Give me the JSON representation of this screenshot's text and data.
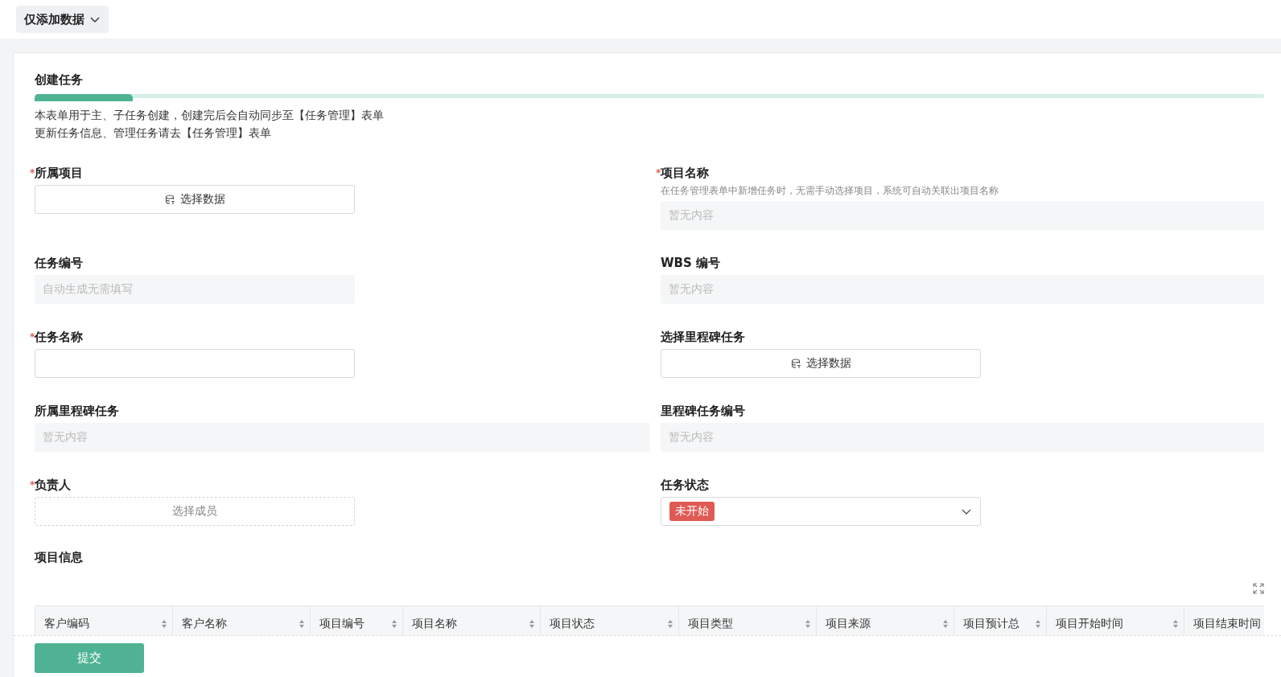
{
  "view_switch": {
    "label": "仅添加数据",
    "expanded": false
  },
  "form": {
    "tab": {
      "label": "创建任务",
      "selected": true
    },
    "description": [
      "本表单用于主、子任务创建，创建完后会自动同步至【任务管理】表单",
      "更新任务信息、管理任务请去【任务管理】表单"
    ],
    "rows": [
      [
        {
          "kind": "picker",
          "marker": "*",
          "label": "所属项目",
          "button": "选择数据"
        },
        {
          "kind": "readonly",
          "marker": "*",
          "label": "项目名称",
          "hint": "在任务管理表单中新增任务时，无需手动选择项目，系统可自动关联出项目名称",
          "placeholder": "暂无内容"
        }
      ],
      [
        {
          "kind": "autonumber",
          "label": "任务编号",
          "placeholder": "自动生成无需填写"
        },
        {
          "kind": "readonly",
          "label": "WBS 编号",
          "placeholder": "暂无内容"
        }
      ],
      [
        {
          "kind": "input",
          "marker": "*",
          "label": "任务名称"
        },
        {
          "kind": "picker",
          "label": "选择里程碑任务",
          "button": "选择数据"
        }
      ],
      [
        {
          "kind": "readonly",
          "label": "所属里程碑任务",
          "placeholder": "暂无内容"
        },
        {
          "kind": "readonly",
          "label": "里程碑任务编号",
          "placeholder": "暂无内容"
        }
      ],
      [
        {
          "kind": "member",
          "marker": "*",
          "label": "负责人",
          "button": "选择成员"
        },
        {
          "kind": "select",
          "label": "任务状态",
          "value": "未开始",
          "color": "#e05a55"
        }
      ]
    ],
    "section": {
      "title": "项目信息",
      "table": {
        "columns": [
          "客户编码",
          "客户名称",
          "项目编号",
          "项目名称",
          "项目状态",
          "项目类型",
          "项目来源",
          "项目预计总",
          "项目开始时间",
          "项目结束时间"
        ]
      }
    },
    "submit": "提交"
  }
}
